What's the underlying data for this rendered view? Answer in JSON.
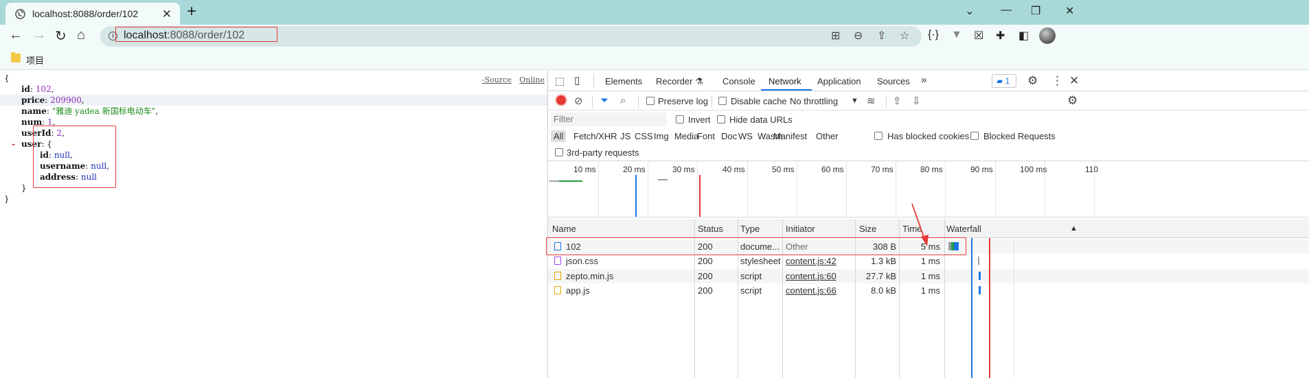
{
  "browser": {
    "tab_title": "localhost:8088/order/102",
    "url_host": "localhost",
    "url_rest": ":8088/order/102",
    "bookmark_folder": "项目"
  },
  "json_viewer": {
    "links": [
      "-Source",
      "Online"
    ],
    "lines": [
      {
        "indent": 0,
        "parts": [
          {
            "c": "punct",
            "t": "{"
          }
        ]
      },
      {
        "indent": 1,
        "parts": [
          {
            "c": "key",
            "t": "id"
          },
          {
            "c": "punct",
            "t": ": "
          },
          {
            "c": "num",
            "t": "102"
          },
          {
            "c": "punct",
            "t": ","
          }
        ]
      },
      {
        "indent": 1,
        "hl": true,
        "parts": [
          {
            "c": "key",
            "t": "price"
          },
          {
            "c": "punct",
            "t": ": "
          },
          {
            "c": "num",
            "t": "209900"
          },
          {
            "c": "punct",
            "t": ","
          }
        ]
      },
      {
        "indent": 1,
        "parts": [
          {
            "c": "key",
            "t": "name"
          },
          {
            "c": "punct",
            "t": ": "
          },
          {
            "c": "str",
            "t": "\"雅迪 yadea 新国标电动车\""
          },
          {
            "c": "punct",
            "t": ","
          }
        ]
      },
      {
        "indent": 1,
        "parts": [
          {
            "c": "key",
            "t": "num"
          },
          {
            "c": "punct",
            "t": ": "
          },
          {
            "c": "num",
            "t": "1"
          },
          {
            "c": "punct",
            "t": ","
          }
        ]
      },
      {
        "indent": 1,
        "parts": [
          {
            "c": "key",
            "t": "userId"
          },
          {
            "c": "punct",
            "t": ": "
          },
          {
            "c": "num",
            "t": "2"
          },
          {
            "c": "punct",
            "t": ","
          }
        ]
      },
      {
        "indent": 1,
        "collapse": "-",
        "parts": [
          {
            "c": "key",
            "t": "user"
          },
          {
            "c": "punct",
            "t": ": {"
          }
        ]
      },
      {
        "indent": 2,
        "parts": [
          {
            "c": "key",
            "t": "id"
          },
          {
            "c": "punct",
            "t": ": "
          },
          {
            "c": "nul",
            "t": "null"
          },
          {
            "c": "punct",
            "t": ","
          }
        ]
      },
      {
        "indent": 2,
        "parts": [
          {
            "c": "key",
            "t": "username"
          },
          {
            "c": "punct",
            "t": ": "
          },
          {
            "c": "nul",
            "t": "null"
          },
          {
            "c": "punct",
            "t": ","
          }
        ]
      },
      {
        "indent": 2,
        "parts": [
          {
            "c": "key",
            "t": "address"
          },
          {
            "c": "punct",
            "t": ": "
          },
          {
            "c": "nul",
            "t": "null"
          }
        ]
      },
      {
        "indent": 1,
        "parts": [
          {
            "c": "punct",
            "t": "}"
          }
        ]
      },
      {
        "indent": 0,
        "parts": [
          {
            "c": "punct",
            "t": "}"
          }
        ]
      }
    ]
  },
  "devtools": {
    "tabs": [
      "Elements",
      "Recorder",
      "Console",
      "Network",
      "Application",
      "Sources"
    ],
    "active_tab": "Network",
    "message_count": "1",
    "preserve_log": "Preserve log",
    "disable_cache": "Disable cache",
    "throttling": "No throttling",
    "filter_placeholder": "Filter",
    "invert": "Invert",
    "hide_data_urls": "Hide data URLs",
    "filter_types": [
      "All",
      "Fetch/XHR",
      "JS",
      "CSS",
      "Img",
      "Media",
      "Font",
      "Doc",
      "WS",
      "Wasm",
      "Manifest",
      "Other"
    ],
    "has_blocked_cookies": "Has blocked cookies",
    "blocked_requests": "Blocked Requests",
    "third_party": "3rd-party requests",
    "ticks": [
      "10 ms",
      "20 ms",
      "30 ms",
      "40 ms",
      "50 ms",
      "60 ms",
      "70 ms",
      "80 ms",
      "90 ms",
      "100 ms",
      "110"
    ],
    "columns": [
      "Name",
      "Status",
      "Type",
      "Initiator",
      "Size",
      "Time",
      "Waterfall"
    ],
    "requests": [
      {
        "name": "102",
        "status": "200",
        "type": "docume...",
        "initiator": "Other",
        "size": "308 B",
        "time": "5 ms",
        "icon": "document"
      },
      {
        "name": "json.css",
        "status": "200",
        "type": "stylesheet",
        "initiator": "content.js:42",
        "size": "1.3 kB",
        "time": "1 ms",
        "icon": "stylesheet"
      },
      {
        "name": "zepto.min.js",
        "status": "200",
        "type": "script",
        "initiator": "content.js:60",
        "size": "27.7 kB",
        "time": "1 ms",
        "icon": "script"
      },
      {
        "name": "app.js",
        "status": "200",
        "type": "script",
        "initiator": "content.js:66",
        "size": "8.0 kB",
        "time": "1 ms",
        "icon": "script"
      }
    ]
  },
  "colors": {
    "accent": "#1a73e8",
    "annotation": "#e53935"
  }
}
